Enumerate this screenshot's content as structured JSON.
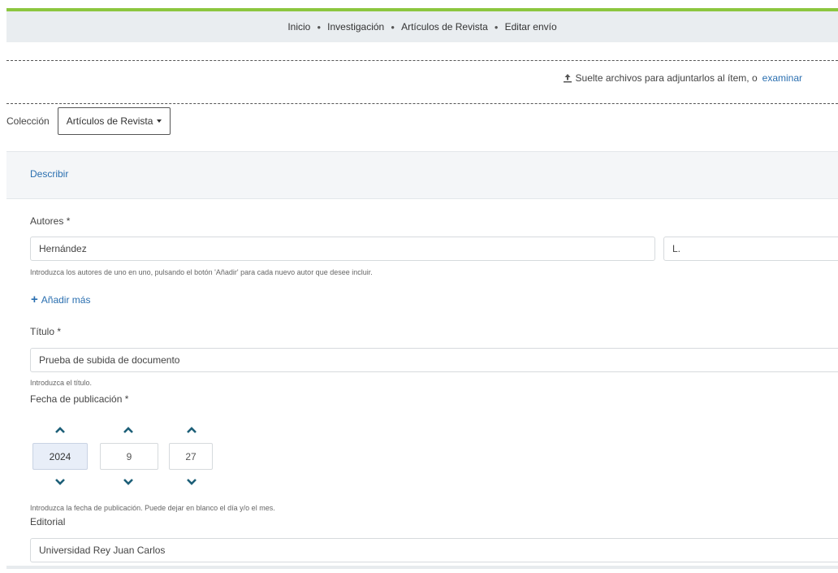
{
  "breadcrumb": {
    "items": [
      "Inicio",
      "Investigación",
      "Artículos de Revista",
      "Editar envío"
    ]
  },
  "dropzone": {
    "message": "Suelte archivos para adjuntarlos al ítem, o",
    "browse_link": "examinar",
    "icon": "upload-icon"
  },
  "collection": {
    "label": "Colección",
    "selected": "Artículos de Revista"
  },
  "tabs": {
    "describe": "Describir"
  },
  "authors": {
    "label": "Autores *",
    "last_name": "Hernández",
    "first_name": "L.",
    "hint": "Introduzca los autores de uno en uno, pulsando el botón 'Añadir' para cada nuevo autor que desee incluir.",
    "add_more": "Añadir más"
  },
  "title_field": {
    "label": "Título *",
    "value": "Prueba de subida de documento",
    "hint": "Introduzca el título."
  },
  "date_field": {
    "label": "Fecha de publicación *",
    "year": "2024",
    "month": "9",
    "day": "27",
    "hint": "Introduzca la fecha de publicación. Puede dejar en blanco el día y/o el mes."
  },
  "publisher_field": {
    "label": "Editorial",
    "value": "Universidad Rey Juan Carlos"
  },
  "colors": {
    "accent_green": "#8cc63f",
    "link_blue": "#2a6fb0",
    "chevron_teal": "#1d5f78"
  }
}
